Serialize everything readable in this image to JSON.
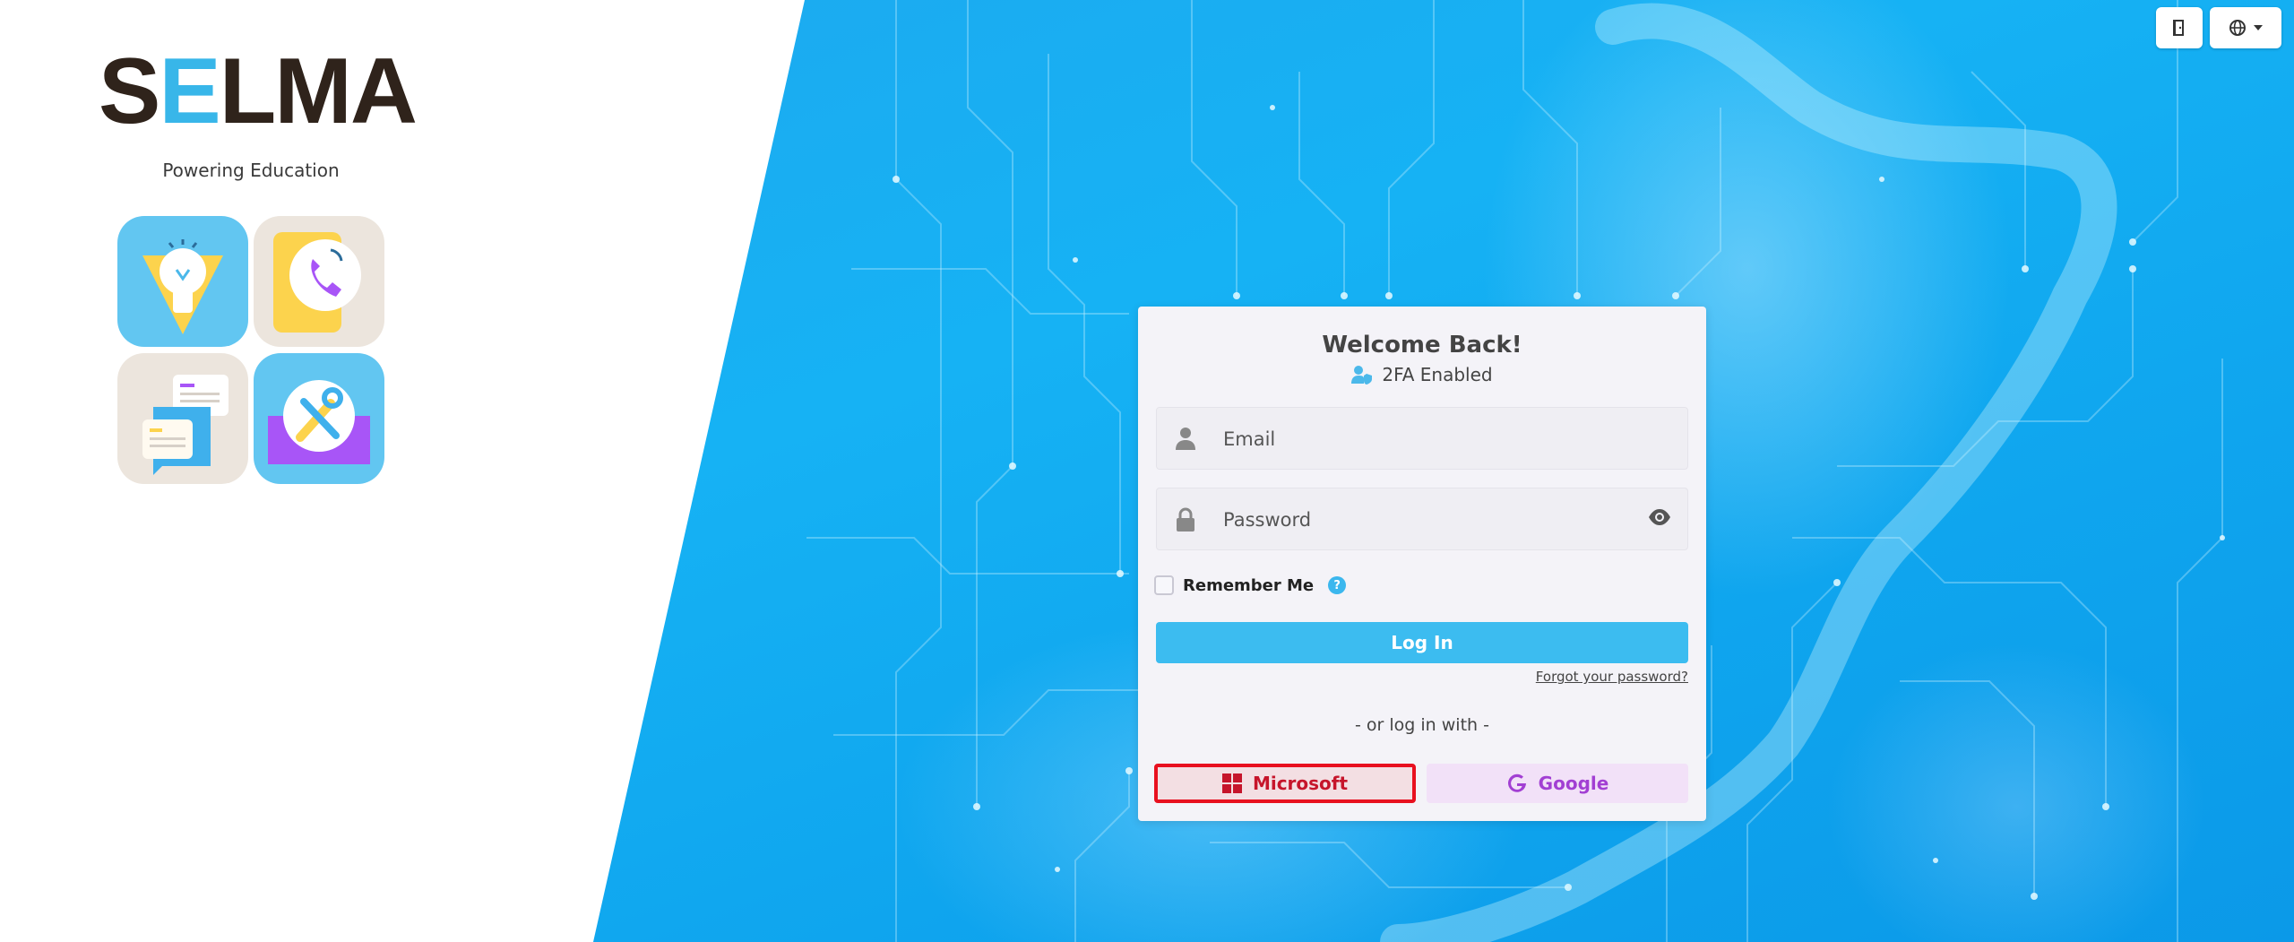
{
  "brand": {
    "logo_prefix": "S",
    "logo_e": "E",
    "logo_suffix": "LMA",
    "tagline": "Powering Education"
  },
  "feature_tiles": [
    {
      "name": "lightbulb"
    },
    {
      "name": "phone"
    },
    {
      "name": "chat"
    },
    {
      "name": "tools"
    }
  ],
  "top_bar": {
    "door_icon": "door-icon",
    "language_icon": "globe-icon"
  },
  "login": {
    "title": "Welcome Back!",
    "subtitle": "2FA Enabled",
    "email_placeholder": "Email",
    "password_placeholder": "Password",
    "remember_label": "Remember Me",
    "help_glyph": "?",
    "login_label": "Log In",
    "forgot_label": "Forgot your password?",
    "divider_label": "- or log in with -",
    "microsoft_label": "Microsoft",
    "google_label": "Google"
  },
  "colors": {
    "accent": "#3cbcf0",
    "microsoft": "#c6152b",
    "google": "#a23fd3",
    "logo_dark": "#2f231b",
    "logo_accent": "#38b6e9"
  }
}
